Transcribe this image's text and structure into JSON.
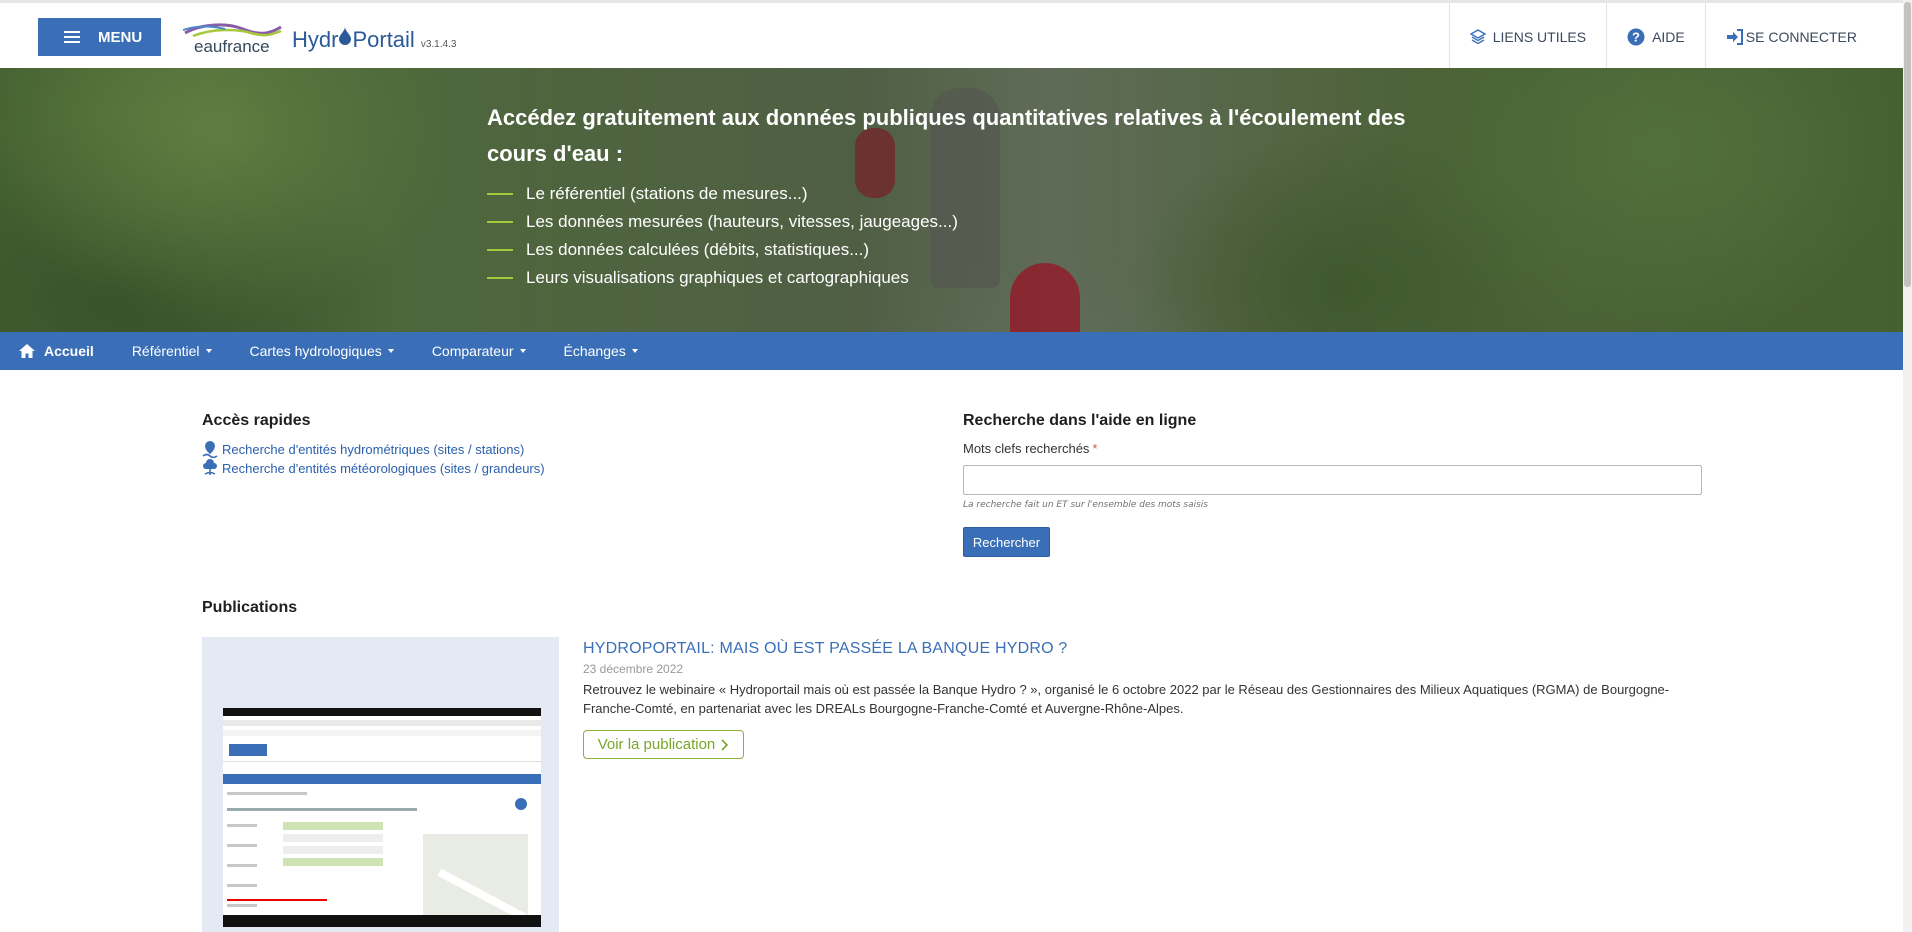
{
  "header": {
    "menu_label": "MENU",
    "logo_eau": "eaufrance",
    "logo_hydro_a": "Hydr",
    "logo_hydro_b": "Portail",
    "version": "v3.1.4.3",
    "links": [
      {
        "label": "LIENS UTILES",
        "icon": "layers-icon"
      },
      {
        "label": "AIDE",
        "icon": "question-circle-icon"
      },
      {
        "label": "SE CONNECTER",
        "icon": "sign-in-icon"
      }
    ]
  },
  "banner": {
    "heading": "Accédez gratuitement aux données publiques quantitatives relatives à l'écoulement des cours d'eau :",
    "items": [
      "Le référentiel (stations de mesures...)",
      "Les données mesurées (hauteurs, vitesses, jaugeages...)",
      "Les données calculées (débits, statistiques...)",
      "Leurs visualisations graphiques et cartographiques"
    ]
  },
  "nav": {
    "items": [
      {
        "label": "Accueil"
      },
      {
        "label": "Référentiel"
      },
      {
        "label": "Cartes hydrologiques"
      },
      {
        "label": "Comparateur"
      },
      {
        "label": "Échanges"
      }
    ]
  },
  "quick_access": {
    "title": "Accès rapides",
    "links": [
      "Recherche d'entités hydrométriques (sites / stations)",
      "Recherche d'entités météorologiques (sites / grandeurs)"
    ]
  },
  "help_search": {
    "title": "Recherche dans l'aide en ligne",
    "label": "Mots clefs recherchés",
    "required_mark": "*",
    "value": "",
    "note": "La recherche fait un ET sur l'ensemble des mots saisis",
    "button": "Rechercher"
  },
  "publications": {
    "title": "Publications",
    "items": [
      {
        "title": "HYDROPORTAIL: MAIS OÙ EST PASSÉE LA BANQUE HYDRO ?",
        "date": "23 décembre 2022",
        "description": "Retrouvez le webinaire « Hydroportail mais où est passée la Banque Hydro ? », organisé le 6 octobre 2022 par le Réseau des Gestionnaires des Milieux Aquatiques (RGMA) de Bourgogne-Franche-Comté, en partenariat avec les DREALs Bourgogne-Franche-Comté et Auvergne-Rhône-Alpes.",
        "button": "Voir la publication"
      }
    ]
  },
  "colors": {
    "primary": "#3a6fb8",
    "accent_green": "#8ab33a",
    "required": "#d9534f"
  }
}
